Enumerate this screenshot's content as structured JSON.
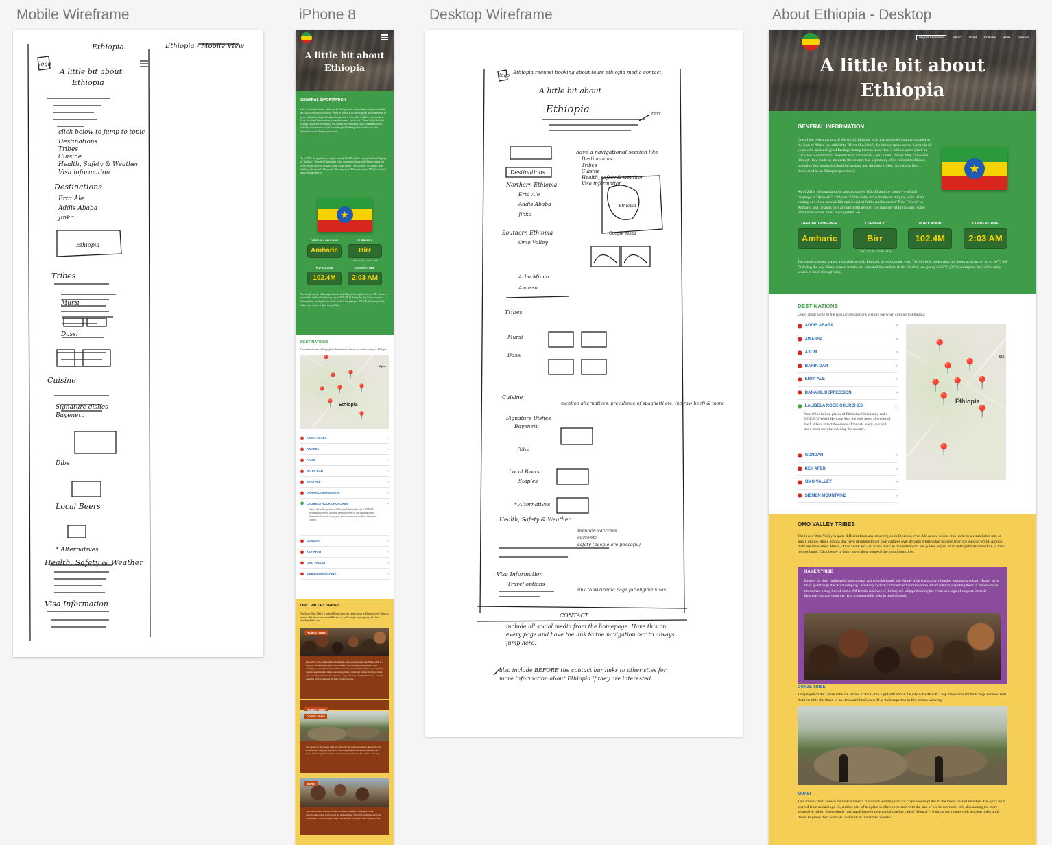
{
  "artboards": {
    "mobile_wireframe": "Mobile Wireframe",
    "iphone8": "iPhone 8",
    "desktop_wireframe": "Desktop Wireframe",
    "about_desktop": "About Ethiopia - Desktop"
  },
  "sketch_mobile": {
    "title": "Ethiopia",
    "view_note": "Ethiopia - Mobile View",
    "logo": "logo",
    "heading1": "A little bit about",
    "heading2": "Ethiopia",
    "click_below": "click below to jump to topic",
    "topics": [
      "Destinations",
      "Tribes",
      "Cuisine",
      "Health, Safety & Weather",
      "Visa information"
    ],
    "destinations": "Destinations",
    "dest_items": [
      "Erta Ale",
      "Addis Ababa",
      "Jinka"
    ],
    "map_label": "Ethiopia",
    "tribes": "Tribes",
    "tribe_items": [
      "Mursi",
      "Dassi"
    ],
    "cuisine": "Cuisine",
    "signature": "Signature dishes",
    "bayenetu": "Bayenetu",
    "dibs": "Dibs",
    "local_beers": "Local Beers",
    "alternatives": "* Alternatives",
    "health": "Health, Safety & Weather",
    "visa": "Visa Information"
  },
  "sketch_desktop": {
    "logo": "logo",
    "nav": "Ethiopia  request booking  about  tours  ethiopia  media  contact",
    "heading1": "A little bit about",
    "heading2": "Ethiopia",
    "text_note": "text",
    "nav_note": "have a navigational section like",
    "nav_list": [
      "Destinations",
      "Tribes",
      "Cuisine",
      "Health, safety & weather",
      "Visa information"
    ],
    "destinations": "Destinations",
    "northern": "Northern Ethiopia",
    "north_items": [
      "Erta Ale",
      "Addis Ababa",
      "Jinka"
    ],
    "google_maps": "Google Maps",
    "map_label": "Ethiopia",
    "southern": "Southern Ethiopia",
    "south_items": [
      "Omo Valley",
      "Arba Minch",
      "Awassa"
    ],
    "tribes": "Tribes",
    "tribe_items": [
      "Mursi",
      "Dassi"
    ],
    "cuisine": "Cuisine",
    "cuisine_note": "mention alternatives, prevalence of spaghetti etc. (no raw beef) & more",
    "signature": "Signature Dishes",
    "bayenetu": "Bayenetu",
    "dibs": "Dibs",
    "local_beers": "Local Beers",
    "staples": "Staples",
    "alternatives": "* Alternatives",
    "health": "Health, Safety & Weather",
    "health_note1": "mention vaccines",
    "health_note2": "currents",
    "health_note3": "safety (people are peaceful)",
    "visa": "Visa Information",
    "travel": "Travel options",
    "visa_note": "link to wikipedia page for eligible visas",
    "contact": "CONTACT",
    "contact_note": "include all social media from the homepage. Have this on every page and have the link to the navigation bar to always jump here.",
    "also_note": "also include BEFORE the contact bar links to other sites for more information about Ethiopia if they are interested."
  },
  "site": {
    "hero_title_line1": "A little bit about",
    "hero_title_line2": "Ethiopia",
    "nav": [
      "REQUEST BOOKING",
      "ABOUT",
      "TOURS",
      "ETHIOPIA",
      "MEDIA",
      "CONTACT"
    ],
    "general_title": "GENERAL INFORMATION",
    "general_p1": "One of the oldest nations of the world, Ethiopia is an extraordinary country situated in the East of Africa (so-called the \"Horn of Africa\"). Its history spans across hundreds of years with archaeological findings dating back to more than 3 million years (such as Lucy, the oldest human ancestor ever discovered – just a link). Never fully colonised (though Italy made an attempt), the country has kept many of its cultural traditions, including its ceremonial ritual for making and drinking coffee (which was first discovered in an Ethiopian province).",
    "general_p2": "As of 2018, the population is approximately 102.4M and the country's official language is \"Amharic\". Orthodox Christianity is the dominant religion, with Islam coming at a close second. Ethiopia's capital Addis Ababa means \"New Flower\" in Amharic, and inhabits only around 4.6M people. The majority of Ethiopians (some 80%) live in rural areas relying either on",
    "stats": [
      {
        "label": "OFFICIAL LANGUAGE",
        "value": "Amharic",
        "sub": ""
      },
      {
        "label": "CURRENCY",
        "value": "Birr",
        "sub": "1 USD = 37 Br , 1 EUR = 43 Br"
      },
      {
        "label": "POPULATION",
        "value": "102.4M",
        "sub": ""
      },
      {
        "label": "CURRENT TIME",
        "value": "2:03 AM",
        "sub": ""
      }
    ],
    "climate": "The steady climate makes it possible to visit Ethiopia throughout the year. The North is cooler than the South and can get up to 20°C (68 F) during the day. Rainy season is between June and September. In the South it can get up to 30°C (86 F) during the day, while rainy season is April through May.",
    "dest_title": "DESTINATIONS",
    "dest_intro": "Learn about some of the popular destinations visitors see when coming to Ethiopia:",
    "destinations": [
      "ADDIS ABABA",
      "AWASSA",
      "AXUM",
      "BAHIR DAR",
      "ERTA ALE",
      "DANAKIL DEPRESSION",
      "LALIBELA ROCK CHURCHES",
      "GONDAR",
      "KEY AFER",
      "OMO VALLEY",
      "SIEMEN MOUNTAINS"
    ],
    "lalibela_desc": "One of the holiest places of Ethiopian Christianity and a UNESCO World Heritage Site, the rock hewn churches of the Lalibela attract thousands of tourists every year and are a must-see when visiting the country.",
    "map_label": "Ethiopia",
    "map_djibouti": "Djibo",
    "map_dji_short": "Dji",
    "omo_title": "OMO VALLEY TRIBES",
    "omo_intro": "The lower Omo Valley is quite different from any other region in Ethiopia, even Africa as a whole. It is home to a remarkable mix of small, unique ethnic groups that have developed their own cultures over decades while being isolated from the outside world. Among them are the Hamer, Mursi, Dorze and Karo - all tribes that can be visited with our guides as part of an unforgettable adventure to their remote lands. Click below to learn more about some of the prominent tribes.",
    "omo_intro_short": "The lower Omo Valley is quite different from any other region in Ethiopia, even Africa as a whole. It is home to a remarkable mix of small, unique ethnic groups that have developed their own",
    "hamer": "HAMER TRIBE",
    "hamer_text": "Known for their fashionable adornments and colorful beads, the Hamer tribe is a strongly bonded pastoralist cohort. Hamer boys must go through the \"Bull Jumping Ceremony\" which commences their transition into manhood, requiting them to leap multiple times over a long line of cattle. All female relatives of the boy are whipped during the event as a sign of support for their kinsmen, earning them the right to demand his help in time of need.",
    "dorze": "DORZE TRIBE",
    "dorze_text": "The people of the Dorze tribe are settled in the Gamo highlands above the city Arba Minch. They are known for their huge bamboo huts that resemble the shape of an elephant's head, as well as their expertise in fine cotton weaving.",
    "mursi": "MURSI",
    "mursi_text": "This tribe is most known for their women's custom of wearing circular clay/wooden plates in the lower lip and earlobes. The girl's lip is pierced from around age 15, and the size of her plate is often correlated with the size of her bridewealth. It is also among the more aggressive tribes, where single men participate in ceremonial dueling called \"Donga\" – fighting each other with wooden poles until defeat to prove their worth as husbands to unmarried women.",
    "mobile_hamer_tag": "HAMER TRIBE",
    "mobile_dorze_text": "The people of the Dorze tribe are settled in the Gamo highlands above the city Arba Minch. They are known for their huge bamboo huts that resemble the shape of an elephant's head, as well as their expertise in fine cotton weaving.",
    "mobile_mursi_text": "This tribe is most known for their women's custom of wearing circular clay/wooden plates in the lower lip and earlobes. The girl's lip is pierced from around age 15, and the size of her plate is often correlated with the size of her"
  },
  "colors": {
    "green": "#3f9c48",
    "yellow": "#f5cf55",
    "purple": "#8c4c9e",
    "brown": "#8b3a16",
    "link_blue": "#2a6ab5",
    "pin_red": "#d7261e"
  },
  "icons": [
    "hamburger-icon",
    "map-pin-icon",
    "chevron-right-icon",
    "chevron-down-icon",
    "flag-emblem-icon"
  ]
}
